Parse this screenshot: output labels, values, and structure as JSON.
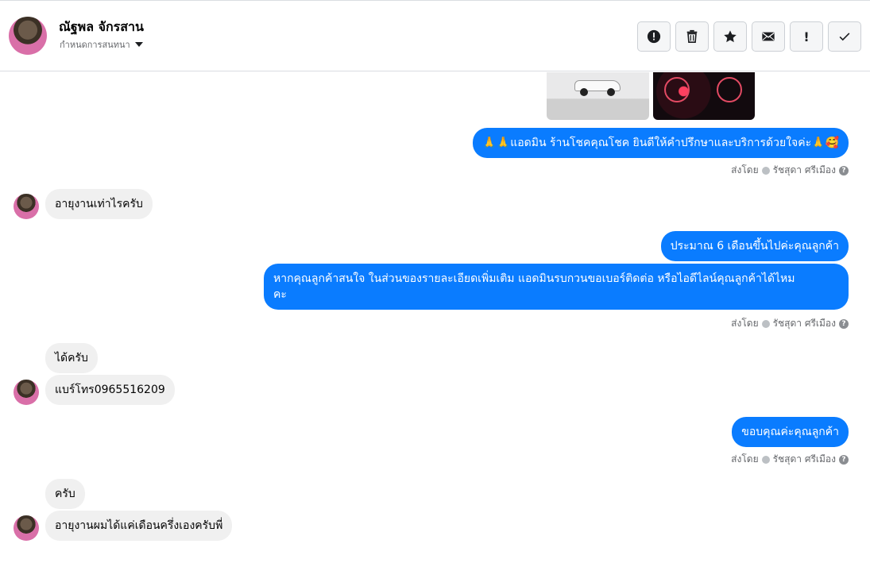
{
  "header": {
    "contact_name": "ณัฐพล จักรสาน",
    "subtitle": "กำหนดการสนทนา"
  },
  "toolbar": {
    "buttons": [
      {
        "icon": "alert-circle-icon"
      },
      {
        "icon": "trash-icon"
      },
      {
        "icon": "star-icon"
      },
      {
        "icon": "mail-icon"
      },
      {
        "icon": "exclamation-icon",
        "label": "!"
      },
      {
        "icon": "check-icon"
      }
    ]
  },
  "messages": {
    "m1": "🙏🙏แอดมิน ร้านโชคคุณโชค ยินดีให้คำปรึกษาและบริการด้วยใจค่ะ🙏🥰",
    "m2": "อายุงานเท่าไรครับ",
    "m3": "ประมาณ 6 เดือนขึ้นไปค่ะคุณลูกค้า",
    "m4_line1": "หากคุณลูกค้าสนใจ ในส่วนของรายละเอียดเพิ่มเติม แอดมินรบกวนขอเบอร์ติดต่อ หรือไอดีไลน์คุณลูกค้าได้ไหม",
    "m4_line2": "คะ",
    "m5": "ได้ครับ",
    "m6": "แบร์โทร0965516209",
    "m7": "ขอบคุณค่ะคุณลูกค้า",
    "m8": "ครับ",
    "m9": "อายุงานผมได้แค่เดือนครึ่งเองครับพี่"
  },
  "sent_by": {
    "prefix": "ส่งโดย",
    "name": "รัชสุดา ศรีเมือง",
    "help": "?"
  },
  "colors": {
    "outgoing_bubble": "#0a7cff",
    "incoming_bubble": "#f0f0f0"
  }
}
